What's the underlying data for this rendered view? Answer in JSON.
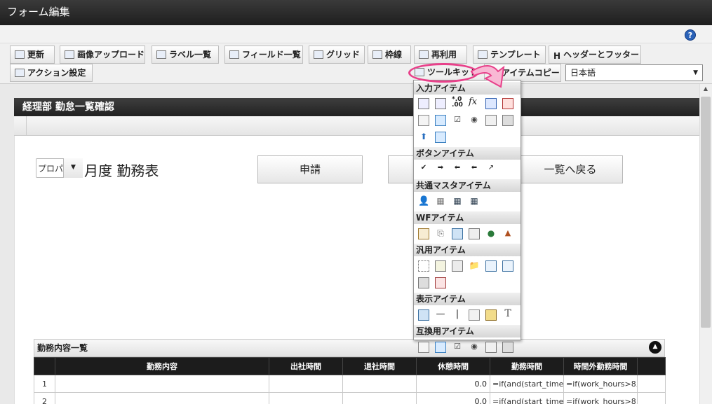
{
  "window": {
    "title": "フォーム編集"
  },
  "toolbar": {
    "row1": [
      "更新",
      "画像アップロード",
      "ラベル一覧",
      "フィールド一覧",
      "グリッド",
      "枠線",
      "再利用",
      "テンプレート",
      "ヘッダーとフッター"
    ],
    "row2": [
      "アクション設定",
      "ツールキット",
      "アイテムコピー"
    ],
    "language": "日本語"
  },
  "form": {
    "title": "経理部 勤怠一覧確認",
    "month_select_value": "プロパ",
    "month_label": "月度 勤務表",
    "buttons": [
      "申請",
      "一覧へ戻る"
    ]
  },
  "toolkit": {
    "sections": [
      "入力アイテム",
      "ボタンアイテム",
      "共通マスタアイテム",
      "WFアイテム",
      "汎用アイテム",
      "表示アイテム",
      "互換用アイテム"
    ]
  },
  "list": {
    "title": "勤務内容一覧",
    "columns": [
      "勤務内容",
      "出社時間",
      "退社時間",
      "休憩時間",
      "勤務時間",
      "時間外勤務時間"
    ],
    "rows": [
      {
        "num": "1",
        "break": "0.0",
        "work_formula": "=if(and(start_time>",
        "overtime_formula": "=if(work_hours>8,"
      },
      {
        "num": "2",
        "break": "0.0",
        "work_formula": "=if(and(start_time>",
        "overtime_formula": "=if(work_hours>8,"
      }
    ]
  },
  "help": {
    "label": "?"
  }
}
